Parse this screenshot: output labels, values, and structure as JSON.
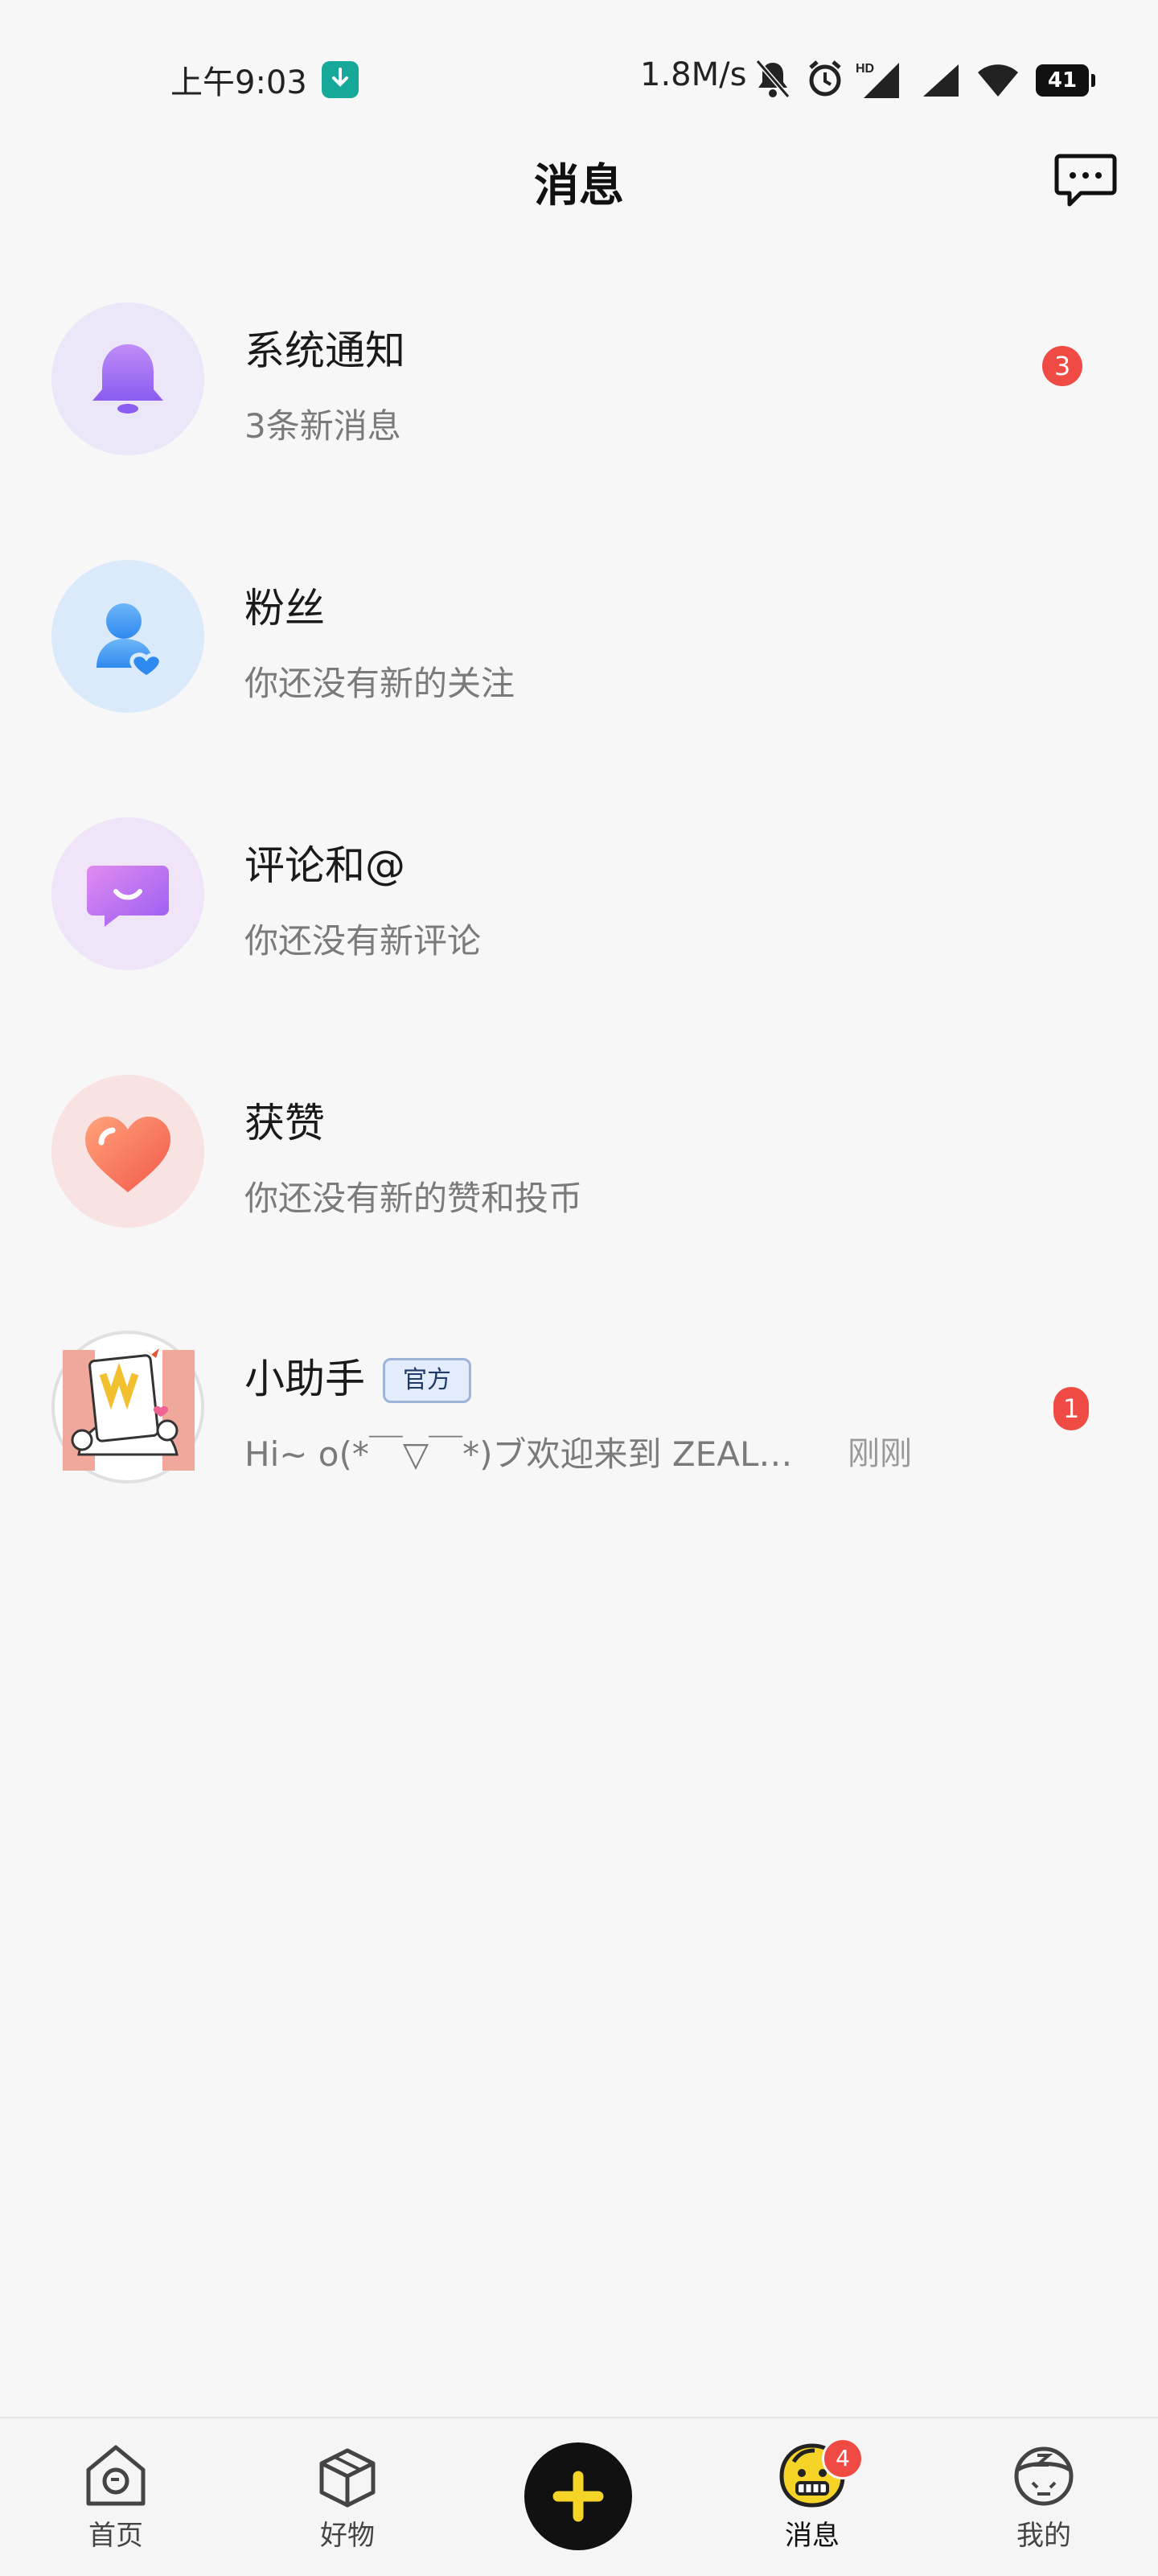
{
  "status_bar": {
    "time": "上午9:03",
    "net_speed": "1.8M/s",
    "battery": "41",
    "hd_label": "HD"
  },
  "header": {
    "title": "消息"
  },
  "messages": [
    {
      "title": "系统通知",
      "subtitle": "3条新消息",
      "badge": "3"
    },
    {
      "title": "粉丝",
      "subtitle": "你还没有新的关注"
    },
    {
      "title": "评论和@",
      "subtitle": "你还没有新评论"
    },
    {
      "title": "获赞",
      "subtitle": "你还没有新的赞和投币"
    },
    {
      "title": "小助手",
      "tag": "官方",
      "subtitle": "Hi~ o(*￣▽￣*)ブ欢迎来到 ZEAL…",
      "time": "刚刚",
      "badge": "1"
    }
  ],
  "bottom_nav": {
    "items": [
      {
        "label": "首页"
      },
      {
        "label": "好物"
      },
      {
        "label": "消息",
        "badge": "4"
      },
      {
        "label": "我的"
      }
    ],
    "plus_icon": "plus-icon"
  },
  "colors": {
    "badge": "#f04a45",
    "accent_yellow": "#f5d327",
    "background": "#f7f7f7"
  },
  "icons": [
    "bell-icon",
    "fans-icon",
    "comment-icon",
    "heart-icon",
    "assistant-avatar",
    "chat-icon"
  ]
}
